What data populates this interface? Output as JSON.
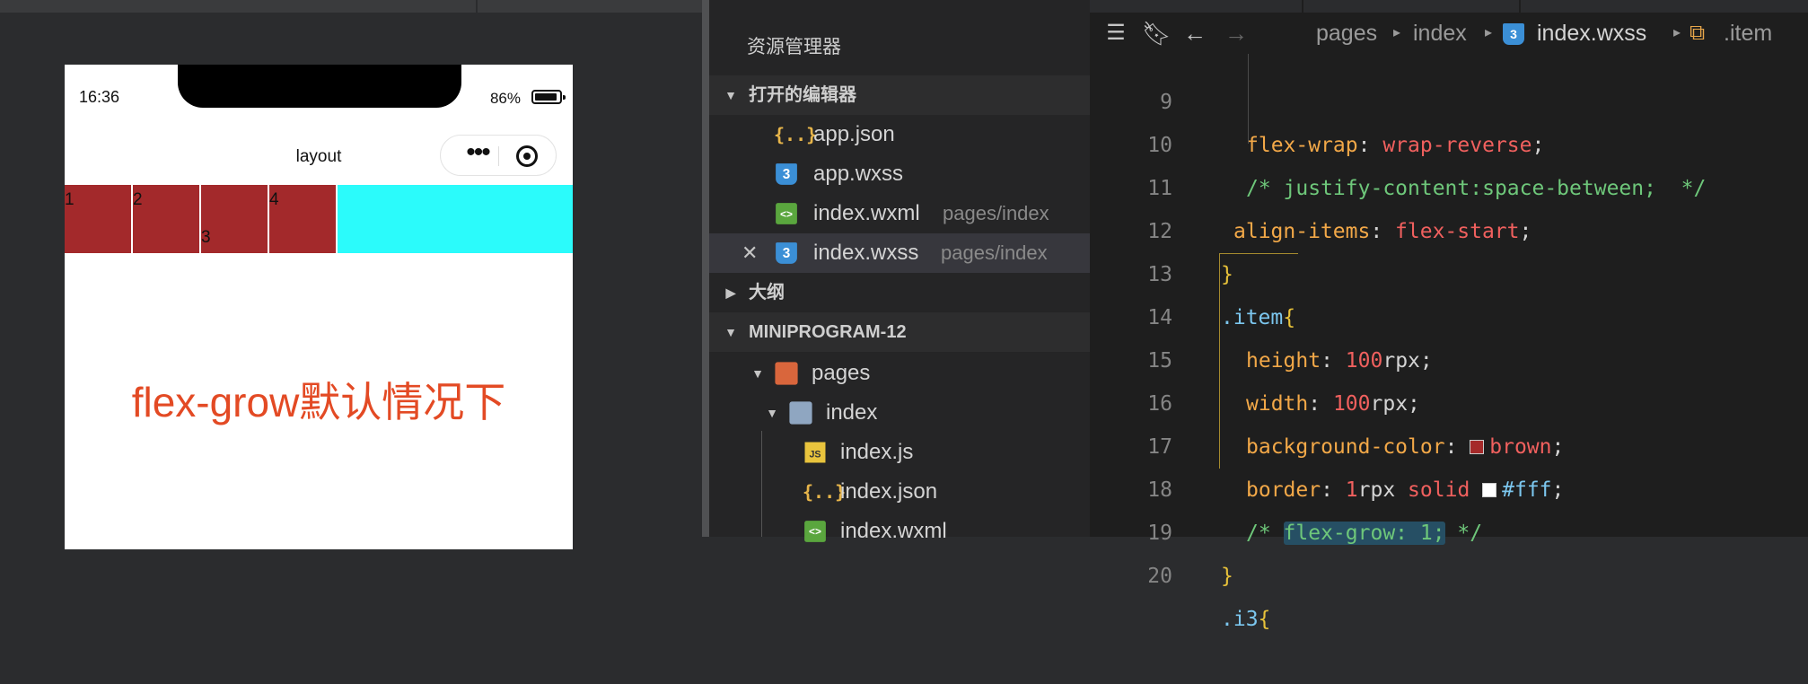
{
  "simulator": {
    "status_time": "16:36",
    "battery_percent": "86%",
    "nav_title": "layout",
    "capsule_menu": "•••",
    "flex_items": [
      "1",
      "2",
      "3",
      "4"
    ],
    "caption": "flex-grow默认情况下",
    "colors": {
      "item_bg": "#a3292b",
      "container_bg": "#2bfbfb",
      "caption": "#e34a24"
    }
  },
  "explorer": {
    "title": "资源管理器",
    "open_editors_label": "打开的编辑器",
    "open_editors": [
      {
        "name": "app.json",
        "icon": "json-icon",
        "sub": ""
      },
      {
        "name": "app.wxss",
        "icon": "css-icon",
        "sub": ""
      },
      {
        "name": "index.wxml",
        "icon": "wxml-icon",
        "sub": "pages/index"
      },
      {
        "name": "index.wxss",
        "icon": "css-icon",
        "sub": "pages/index",
        "active": true
      }
    ],
    "outline_label": "大纲",
    "project_label": "MINIPROGRAM-12",
    "tree": [
      {
        "name": "pages",
        "icon": "folder-open-icon"
      },
      {
        "name": "index",
        "icon": "folder-icon"
      },
      {
        "name": "index.js",
        "icon": "js-icon"
      },
      {
        "name": "index.json",
        "icon": "json-icon"
      },
      {
        "name": "index.wxml",
        "icon": "wxml-icon"
      }
    ],
    "icon_glyphs": {
      "json": "{..}",
      "css": "3",
      "wxml": "<>",
      "js": "JS"
    }
  },
  "editor": {
    "breadcrumb": {
      "seg1": "pages",
      "seg2": "index",
      "file": "index.wxss",
      "symbol": ".item"
    },
    "toolbar_icons": [
      "list-icon",
      "bookmark-icon",
      "back-arrow-icon",
      "forward-arrow-icon"
    ],
    "lines": {
      "l9": {
        "num": "9",
        "prop": "flex-wrap",
        "colon": ": ",
        "val": "wrap-reverse",
        "semi": ";"
      },
      "l10": {
        "num": "10",
        "comment": "/* justify-content:space-between;  */"
      },
      "l11": {
        "num": "11",
        "prop": "align-items",
        "colon": ": ",
        "val": "flex-start",
        "semi": ";"
      },
      "l12": {
        "num": "12",
        "text": "}"
      },
      "l13": {
        "num": "13",
        "selector": ".item",
        "brace": "{"
      },
      "l14": {
        "num": "14",
        "prop": "height",
        "colon": ": ",
        "num_val": "100",
        "unit": "rpx",
        "semi": ";"
      },
      "l15": {
        "num": "15",
        "prop": "width",
        "colon": ": ",
        "num_val": "100",
        "unit": "rpx",
        "semi": ";"
      },
      "l16": {
        "num": "16",
        "prop": "background-color",
        "colon": ": ",
        "val": "brown",
        "semi": ";",
        "swatch": "#a52a2a"
      },
      "l17": {
        "num": "17",
        "prop": "border",
        "colon": ": ",
        "num_val": "1",
        "unit": "rpx",
        "val": " solid ",
        "val2": "#fff",
        "semi": ";",
        "swatch": "#ffffff"
      },
      "l18": {
        "num": "18",
        "c_open": "/* ",
        "c_hl": "flex-grow: 1;",
        "c_close": " */"
      },
      "l19": {
        "num": "19",
        "text": "}"
      },
      "l20": {
        "num": "20",
        "selector": ".i3",
        "brace": "{"
      }
    }
  }
}
